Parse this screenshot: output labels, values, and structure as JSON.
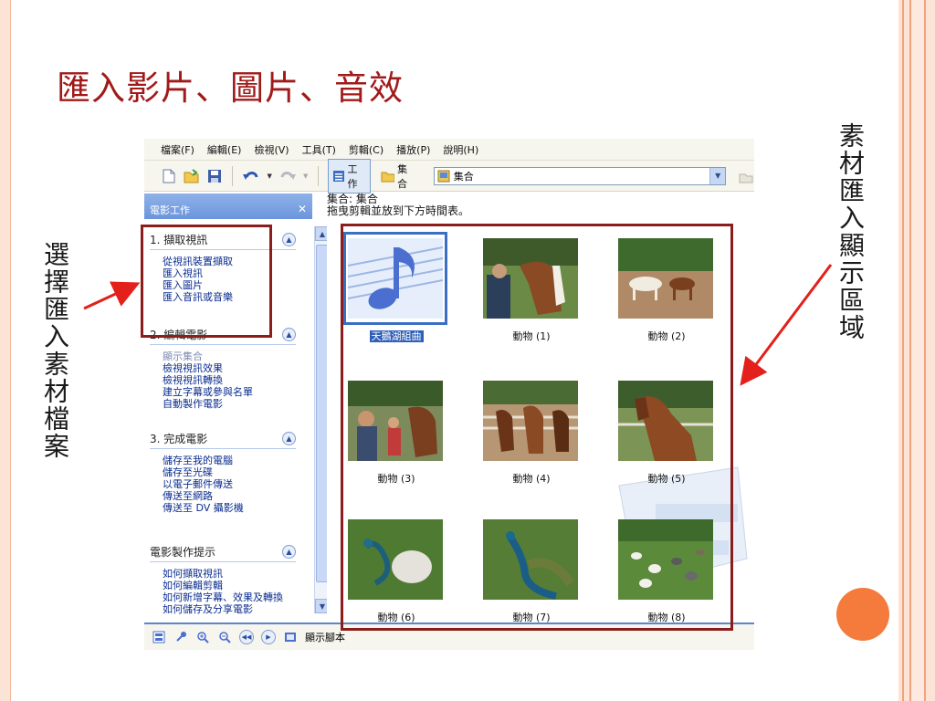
{
  "slide": {
    "title": "匯入影片、圖片、音效",
    "left_callout": "選擇匯入素材檔案",
    "right_callout": "素材匯入顯示區域"
  },
  "colors": {
    "title": "#a11a1a",
    "highlight": "#8b1d1d",
    "arrow": "#e3201b",
    "accent_circle": "#f47b3c",
    "selection": "#2f5fb8"
  },
  "menu": [
    "檔案(F)",
    "編輯(E)",
    "檢視(V)",
    "工具(T)",
    "剪輯(C)",
    "播放(P)",
    "說明(H)"
  ],
  "toolbar": {
    "work_label": "工作",
    "collection_label": "集合",
    "combo_value": "集合"
  },
  "pane": {
    "header": "電影工作",
    "sections": [
      {
        "title": "1. 擷取視訊",
        "links": [
          "從視訊裝置擷取",
          "匯入視訊",
          "匯入圖片",
          "匯入音訊或音樂"
        ]
      },
      {
        "title": "2. 編輯電影",
        "links": [
          "顯示集合",
          "檢視視訊效果",
          "檢視視訊轉換",
          "建立字幕或參與名單",
          "自動製作電影"
        ]
      },
      {
        "title": "3. 完成電影",
        "links": [
          "儲存至我的電腦",
          "儲存至光碟",
          "以電子郵件傳送",
          "傳送至網路",
          "傳送至 DV 攝影機"
        ]
      },
      {
        "title": "電影製作提示",
        "links": [
          "如何擷取視訊",
          "如何編輯剪輯",
          "如何新增字幕、效果及轉換",
          "如何儲存及分享電影"
        ]
      }
    ]
  },
  "content": {
    "header": "集合: 集合",
    "subheader": "拖曳剪輯並放到下方時間表。",
    "items": [
      {
        "label": "天鵝湖組曲",
        "icon": "music-note-icon",
        "selected": true
      },
      {
        "label": "動物 (1)",
        "icon": "horse-photo"
      },
      {
        "label": "動物 (2)",
        "icon": "horses-field-photo"
      },
      {
        "label": "動物 (3)",
        "icon": "crowd-horse-photo"
      },
      {
        "label": "動物 (4)",
        "icon": "horses-fence-photo"
      },
      {
        "label": "動物 (5)",
        "icon": "horse-closeup-photo"
      },
      {
        "label": "動物 (6)",
        "icon": "peacock-photo"
      },
      {
        "label": "動物 (7)",
        "icon": "peacock-photo"
      },
      {
        "label": "動物 (8)",
        "icon": "birds-lawn-photo"
      }
    ]
  },
  "status": {
    "storyboard_label": "顯示腳本"
  }
}
